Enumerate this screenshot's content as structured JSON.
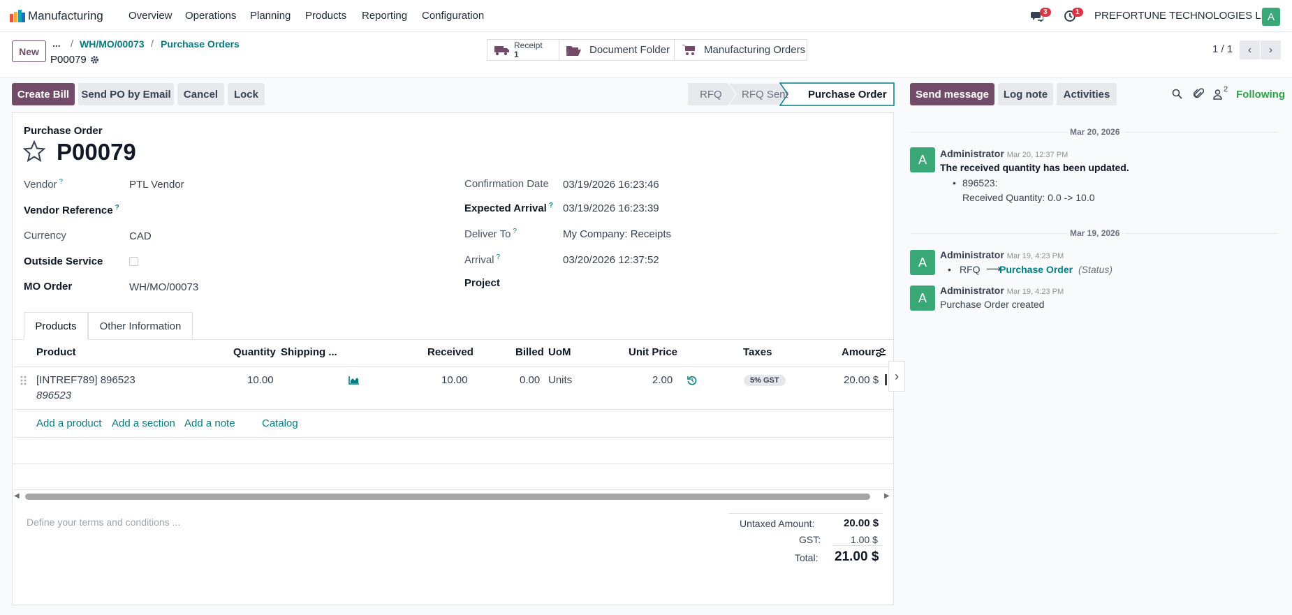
{
  "app": {
    "name": "Manufacturing",
    "logo_colors": [
      "#e6553a",
      "#f4a93b",
      "#15a2b6",
      "#1e6fc3"
    ]
  },
  "nav": {
    "menus": [
      "Overview",
      "Operations",
      "Planning",
      "Products",
      "Reporting",
      "Configuration"
    ],
    "messages_count": "3",
    "activities_count": "1",
    "company": "PREFORTUNE TECHNOLOGIES LLP",
    "user_initial": "A"
  },
  "breadcrumb": {
    "new_label": "New",
    "more": "...",
    "items": [
      "WH/MO/00073",
      "Purchase Orders"
    ],
    "current": "P00079"
  },
  "smart_buttons": {
    "receipt_label": "Receipt",
    "receipt_count": "1",
    "document_folder": "Document Folder",
    "manufacturing_orders": "Manufacturing Orders"
  },
  "pager": {
    "value": "1 / 1"
  },
  "actions": {
    "create_bill": "Create Bill",
    "send_po": "Send PO by Email",
    "cancel": "Cancel",
    "lock": "Lock"
  },
  "status": {
    "steps": [
      "RFQ",
      "RFQ Sent",
      "Purchase Order"
    ],
    "active": "Purchase Order"
  },
  "form": {
    "title_label": "Purchase Order",
    "name": "P00079",
    "left": {
      "vendor_label": "Vendor",
      "vendor": "PTL Vendor",
      "vendor_ref_label": "Vendor Reference",
      "currency_label": "Currency",
      "currency": "CAD",
      "outside_service_label": "Outside Service",
      "mo_order_label": "MO Order",
      "mo_order": "WH/MO/00073"
    },
    "right": {
      "confirmation_date_label": "Confirmation Date",
      "confirmation_date": "03/19/2026 16:23:46",
      "expected_arrival_label": "Expected Arrival",
      "expected_arrival": "03/19/2026 16:23:39",
      "deliver_to_label": "Deliver To",
      "deliver_to": "My Company: Receipts",
      "arrival_label": "Arrival",
      "arrival": "03/20/2026 12:37:52",
      "project_label": "Project"
    },
    "tabs": [
      "Products",
      "Other Information"
    ]
  },
  "lines": {
    "headers": {
      "product": "Product",
      "quantity": "Quantity",
      "shipping": "Shipping ...",
      "received": "Received",
      "billed": "Billed",
      "uom": "UoM",
      "unit_price": "Unit Price",
      "taxes": "Taxes",
      "amount": "Amour"
    },
    "row": {
      "product": "[INTREF789] 896523",
      "description": "896523",
      "quantity": "10.00",
      "received": "10.00",
      "billed": "0.00",
      "uom": "Units",
      "unit_price": "2.00",
      "tax": "5% GST",
      "amount": "20.00 $"
    },
    "add_product": "Add a product",
    "add_section": "Add a section",
    "add_note": "Add a note",
    "catalog": "Catalog"
  },
  "terms_placeholder": "Define your terms and conditions ...",
  "totals": {
    "untaxed_label": "Untaxed Amount:",
    "untaxed": "20.00 $",
    "gst_label": "GST:",
    "gst": "1.00 $",
    "total_label": "Total:",
    "total": "21.00 $"
  },
  "chatter": {
    "send_message": "Send message",
    "log_note": "Log note",
    "activities": "Activities",
    "followers_count": "2",
    "following": "Following",
    "date1": "Mar 20, 2026",
    "msg1": {
      "author": "Administrator",
      "time": "Mar 20, 12:37 PM",
      "body": "The received quantity has been updated.",
      "item1": "896523:",
      "item2": "Received Quantity: 0.0 -> 10.0"
    },
    "date2": "Mar 19, 2026",
    "msg2": {
      "author": "Administrator",
      "time": "Mar 19, 4:23 PM",
      "from": "RFQ",
      "to": "Purchase Order",
      "field": "(Status)"
    },
    "msg3": {
      "author": "Administrator",
      "time": "Mar 19, 4:23 PM",
      "body": "Purchase Order created"
    }
  },
  "colors": {
    "primary": "#714b67",
    "link": "#017e84",
    "avatar": "#3aa776"
  }
}
